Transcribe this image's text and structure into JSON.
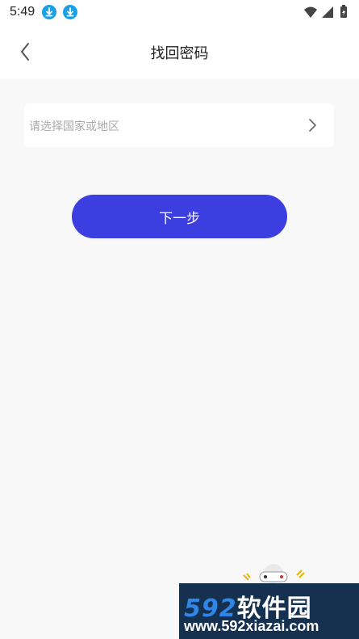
{
  "status_bar": {
    "time": "5:49",
    "icons": [
      "download-icon",
      "download-icon",
      "wifi-icon",
      "signal-icon",
      "battery-icon"
    ]
  },
  "header": {
    "title": "找回密码",
    "back_icon": "chevron-left-icon"
  },
  "form": {
    "region_placeholder": "请选择国家或地区",
    "region_arrow_icon": "chevron-right-icon"
  },
  "actions": {
    "next_label": "下一步"
  },
  "watermark": {
    "brand_num": "592",
    "brand_text": "软件园",
    "url": "www.592xiazai.com"
  },
  "colors": {
    "accent": "#3c3ee0",
    "background": "#f8f8f8",
    "placeholder": "#a9a9a9"
  }
}
